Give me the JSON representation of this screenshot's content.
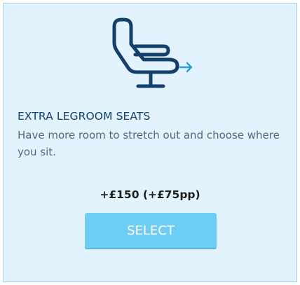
{
  "card": {
    "icon": "reclining-seat-icon",
    "accent_icon": "arrow-right-icon",
    "title": "EXTRA LEGROOM SEATS",
    "description": "Have more room to stretch out and choose where you sit.",
    "price": "+£150 (+£75pp)",
    "select_label": "SELECT"
  },
  "colors": {
    "card_background": "#e2f3fd",
    "card_border": "#9fd0ea",
    "icon_navy": "#143f6b",
    "arrow_blue": "#2aa0dc",
    "button_background": "#6ecdf3",
    "button_text": "#ffffff"
  }
}
